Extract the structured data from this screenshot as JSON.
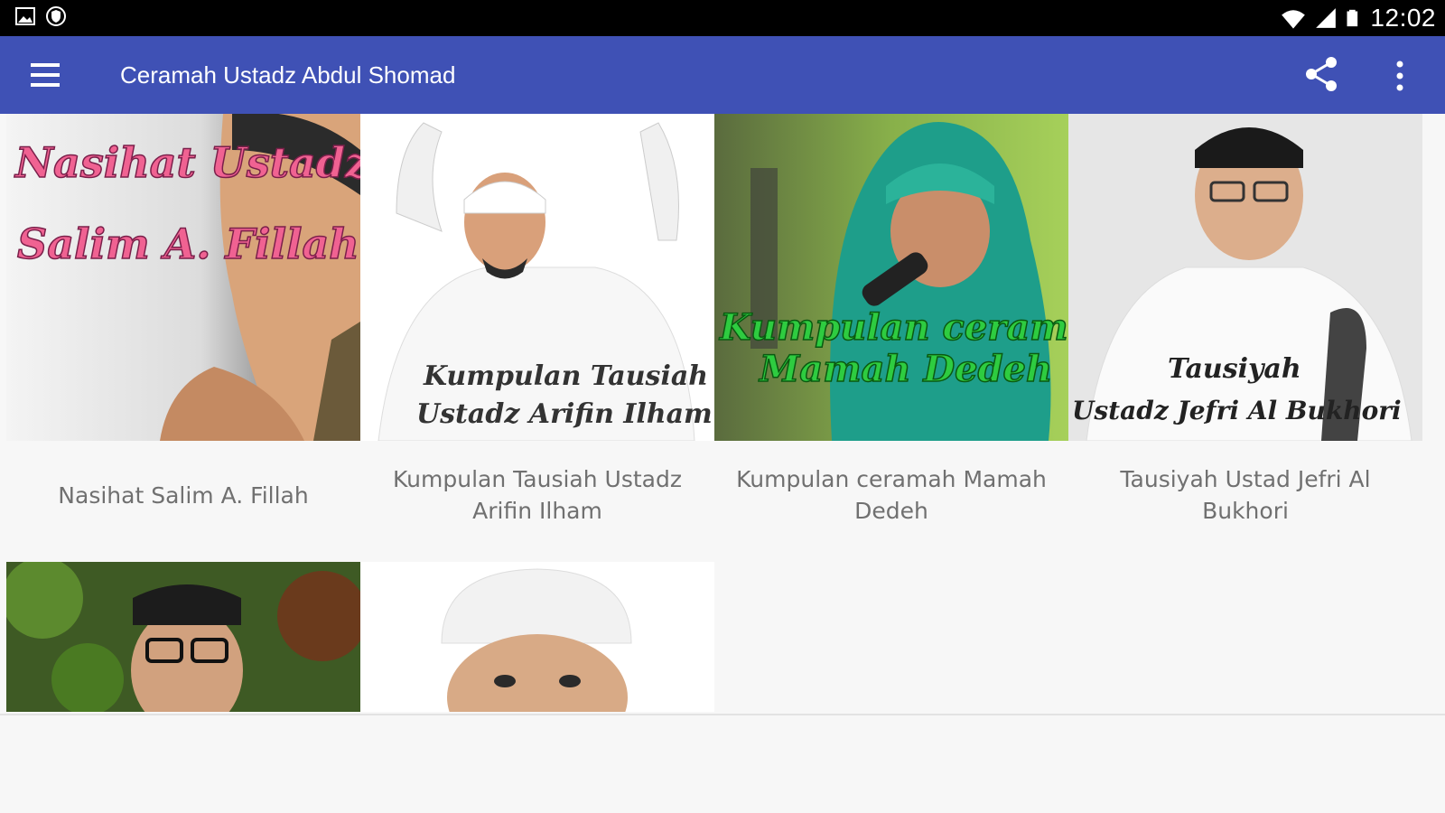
{
  "status_bar": {
    "time": "12:02",
    "icons": [
      "image-icon",
      "shield-icon",
      "wifi-icon",
      "signal-icon",
      "battery-icon"
    ]
  },
  "app_bar": {
    "title": "Ceramah Ustadz Abdul Shomad",
    "color": "#3f51b5",
    "icons": [
      "menu-icon",
      "share-icon",
      "more-vert-icon"
    ]
  },
  "items": [
    {
      "caption": "Nasihat Salim A. Fillah",
      "thumb_text": [
        "Nasihat Ustadz",
        "Salim A. Fillah"
      ],
      "thumb_text_color": "#f06292"
    },
    {
      "caption": "Kumpulan Tausiah Ustadz Arifin Ilham",
      "thumb_text": [
        "Kumpulan Tausiah",
        "Ustadz Arifin Ilham"
      ],
      "thumb_text_color": "#333333"
    },
    {
      "caption": "Kumpulan ceramah Mamah Dedeh",
      "thumb_text": [
        "Kumpulan ceramah",
        "Mamah Dedeh"
      ],
      "thumb_text_color": "#2ecc40"
    },
    {
      "caption": "Tausiyah Ustad Jefri Al Bukhori",
      "thumb_text": [
        "Tausiyah",
        "Ustadz Jefri Al Bukhori"
      ],
      "thumb_text_color": "#222222"
    },
    {
      "caption": "",
      "thumb_text": []
    },
    {
      "caption": "",
      "thumb_text": []
    }
  ]
}
